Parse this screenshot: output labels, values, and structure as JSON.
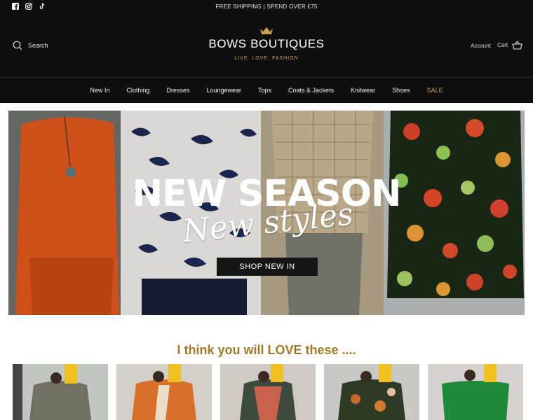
{
  "announcement": "FREE SHIPPING | SPEND OVER £75",
  "social": {
    "icons": [
      "facebook-icon",
      "instagram-icon",
      "tiktok-icon"
    ]
  },
  "header": {
    "search_label": "Search",
    "logo_bold": "BOWS",
    "logo_light": "BOUTIQUES",
    "tagline": "LIVE. LOVE. FASHION",
    "account_label": "Account",
    "cart_label": "Cart"
  },
  "nav": {
    "items": [
      {
        "label": "New In"
      },
      {
        "label": "Clothing"
      },
      {
        "label": "Dresses"
      },
      {
        "label": "Loungewear"
      },
      {
        "label": "Tops"
      },
      {
        "label": "Coats & Jackets"
      },
      {
        "label": "Knitwear"
      },
      {
        "label": "Shoes"
      },
      {
        "label": "SALE"
      }
    ]
  },
  "hero": {
    "title": "NEW SEASON",
    "script": "New styles",
    "button_label": "SHOP NEW IN"
  },
  "recommend": {
    "title": "I think you will LOVE these ...."
  },
  "colors": {
    "header_bg": "#0e0e0e",
    "accent_gold": "#c9a049",
    "heading_gold": "#a07a2a"
  }
}
